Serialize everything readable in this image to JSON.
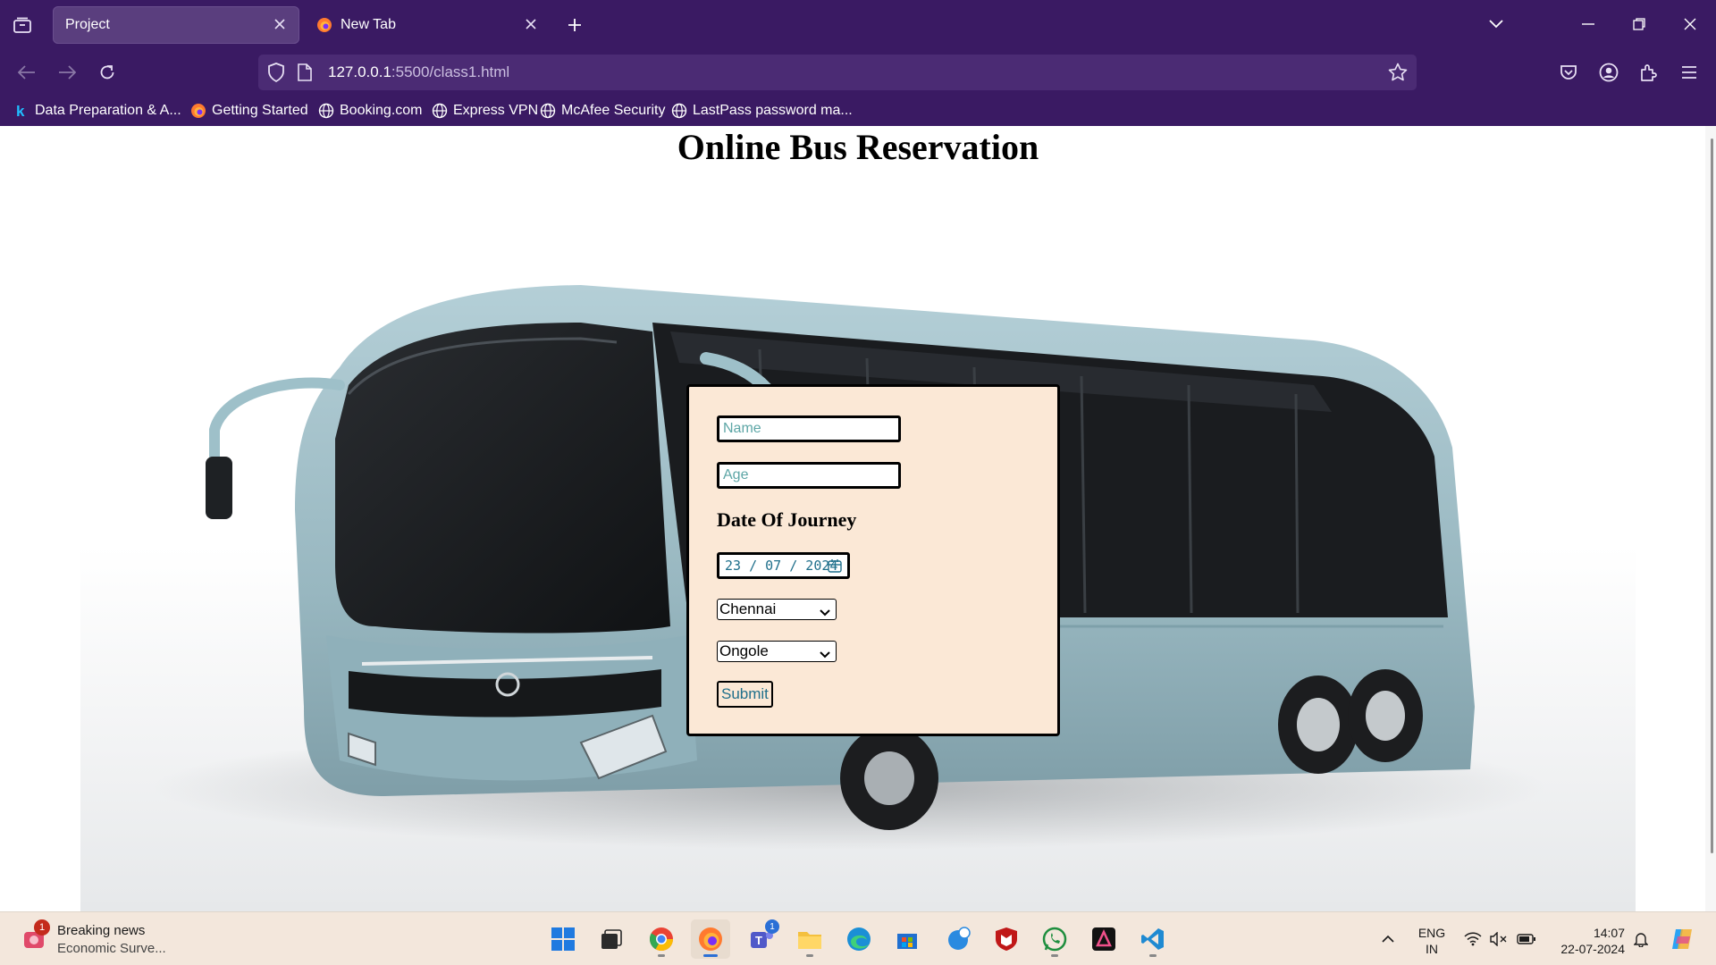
{
  "browser": {
    "tabs": [
      {
        "title": "Project",
        "active": true
      },
      {
        "title": "New Tab",
        "active": false
      }
    ],
    "url": {
      "host": "127.0.0.1",
      "rest": ":5500/class1.html"
    },
    "bookmarks": [
      {
        "label": "Data Preparation & A...",
        "icon": "kaggle-icon"
      },
      {
        "label": "Getting Started",
        "icon": "firefox-icon"
      },
      {
        "label": "Booking.com",
        "icon": "globe-icon"
      },
      {
        "label": "Express VPN",
        "icon": "globe-icon"
      },
      {
        "label": "McAfee Security",
        "icon": "globe-icon"
      },
      {
        "label": "LastPass password ma...",
        "icon": "globe-icon"
      }
    ],
    "colors": {
      "chrome": "#3a1a63",
      "urlbar": "#4b2b74"
    }
  },
  "page": {
    "title": "Online Bus Reservation",
    "form": {
      "name_placeholder": "Name",
      "age_placeholder": "Age",
      "doj_label": "Date Of Journey",
      "date_value": "23 / 07 / 2024",
      "from_value": "Chennai",
      "to_value": "Ongole",
      "submit_label": "Submit"
    },
    "colors": {
      "form_bg": "#fbe8d6",
      "accent": "#1f6f8b"
    }
  },
  "taskbar": {
    "news": {
      "title": "Breaking news",
      "subtitle": "Economic Surve...",
      "badge": "1"
    },
    "teams_badge": "1",
    "language": {
      "line1": "ENG",
      "line2": "IN"
    },
    "clock": {
      "time": "14:07",
      "date": "22-07-2024"
    }
  }
}
